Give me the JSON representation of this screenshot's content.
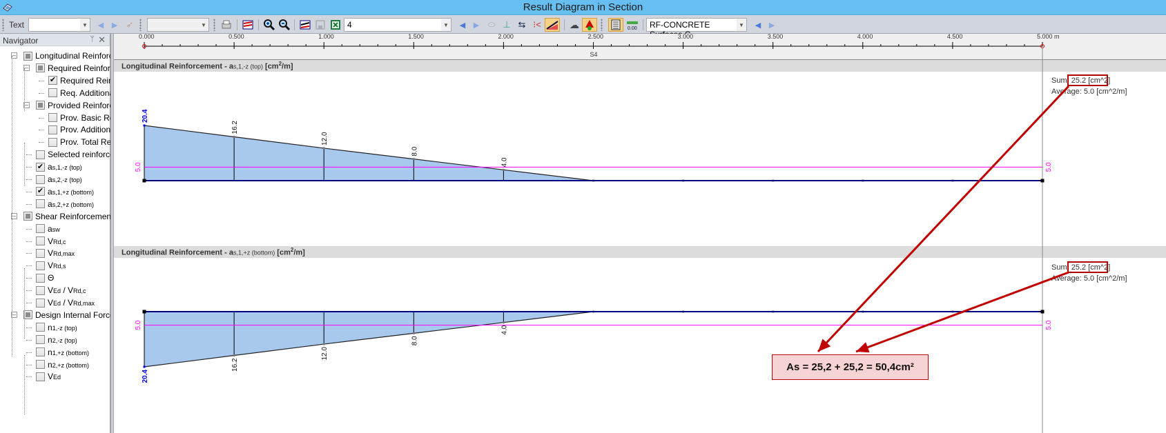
{
  "window": {
    "title": "Result Diagram in Section"
  },
  "toolbar": {
    "text_label": "Text",
    "text_combo_value": "",
    "combo2_value": "",
    "number_field_value": "4",
    "module_combo_value": "RF-CONCRETE Surfaces C"
  },
  "navigator": {
    "title": "Navigator",
    "items": [
      {
        "label": "Longitudinal Reinforc",
        "state": "partial",
        "level": 0,
        "expanded": true
      },
      {
        "label": "Required Reinforc",
        "state": "partial",
        "level": 1,
        "expanded": true
      },
      {
        "label": "Required Reinf",
        "state": "checked",
        "level": 2
      },
      {
        "label": "Req. Additiona",
        "state": "unchecked",
        "level": 2
      },
      {
        "label": "Provided Reinforc",
        "state": "partial",
        "level": 1,
        "expanded": true
      },
      {
        "label": "Prov. Basic Rei",
        "state": "unchecked",
        "level": 2
      },
      {
        "label": "Prov. Addition",
        "state": "unchecked",
        "level": 2
      },
      {
        "label": "Prov. Total Rei",
        "state": "unchecked",
        "level": 2
      },
      {
        "label": "Selected reinforce",
        "state": "unchecked",
        "level": 1
      },
      {
        "label": "a",
        "sub": "s,1,-z (top)",
        "state": "checked",
        "level": 1
      },
      {
        "label": "a",
        "sub": "s,2,-z (top)",
        "state": "unchecked",
        "level": 1
      },
      {
        "label": "a",
        "sub": "s,1,+z (bottom)",
        "state": "checked",
        "level": 1
      },
      {
        "label": "a",
        "sub": "s,2,+z (bottom)",
        "state": "unchecked",
        "level": 1
      },
      {
        "label": "Shear Reinforcement",
        "state": "partial",
        "level": 0,
        "expanded": true
      },
      {
        "label": "a",
        "sub": "sw",
        "state": "unchecked",
        "level": 1
      },
      {
        "label": "V",
        "sub": "Rd,c",
        "state": "unchecked",
        "level": 1
      },
      {
        "label": "V",
        "sub": "Rd,max",
        "state": "unchecked",
        "level": 1
      },
      {
        "label": "V",
        "sub": "Rd,s",
        "state": "unchecked",
        "level": 1
      },
      {
        "label": "Θ",
        "sub": "",
        "state": "unchecked",
        "level": 1
      },
      {
        "label": "V",
        "sub": "Ed",
        "label2": " / V",
        "sub2": "Rd,c",
        "state": "unchecked",
        "level": 1
      },
      {
        "label": "V",
        "sub": "Ed",
        "label2": " / V",
        "sub2": "Rd,max",
        "state": "unchecked",
        "level": 1
      },
      {
        "label": "Design Internal Forces",
        "state": "partial",
        "level": 0,
        "expanded": true
      },
      {
        "label": "n",
        "sub": "1,-z (top)",
        "state": "unchecked",
        "level": 1
      },
      {
        "label": "n",
        "sub": "2,-z (top)",
        "state": "unchecked",
        "level": 1
      },
      {
        "label": "n",
        "sub": "1,+z (bottom)",
        "state": "unchecked",
        "level": 1
      },
      {
        "label": "n",
        "sub": "2,+z (bottom)",
        "state": "unchecked",
        "level": 1
      },
      {
        "label": "V",
        "sub": "Ed",
        "state": "unchecked",
        "level": 1
      }
    ]
  },
  "ruler": {
    "ticks": [
      "0.000",
      "0.500",
      "1.000",
      "1.500",
      "2.000",
      "2.500",
      "3.000",
      "3.500",
      "4.000",
      "4.500",
      "5.000 m"
    ],
    "section_label": "S4"
  },
  "panels": {
    "top": {
      "title": "Longitudinal Reinforcement - a",
      "title_sub": "s,1,-z (top)",
      "unit_pre": "[cm",
      "unit_sup": "2",
      "unit_post": "/m]",
      "sum_label": "Sum: ",
      "sum_value": "25.2 [cm^2]",
      "average": "Average: 5.0 [cm^2/m]"
    },
    "bottom": {
      "title": "Longitudinal Reinforcement - a",
      "title_sub": "s,1,+z (bottom)",
      "unit_pre": "[cm",
      "unit_sup": "2",
      "unit_post": "/m]",
      "sum_label": "Sum: ",
      "sum_value": "25.2 [cm^2]",
      "average": "Average: 5.0 [cm^2/m]"
    }
  },
  "callout": {
    "text": "As = 25,2 + 25,2 = 50,4cm²"
  },
  "colors": {
    "fill": "#a8c8ee",
    "average_line": "#ff00ff",
    "max_label": "#0000ee",
    "axis": "#000080",
    "arrow": "#c00000"
  },
  "chart_data": [
    {
      "type": "area",
      "title": "Longitudinal Reinforcement - a s,1,-z (top) [cm2/m]",
      "xlabel": "m",
      "xlim": [
        0,
        5.0
      ],
      "x": [
        0.0,
        0.5,
        1.0,
        1.5,
        2.0,
        2.5,
        3.0,
        3.5,
        4.0,
        4.5,
        5.0
      ],
      "values": [
        20.4,
        16.2,
        12.0,
        8.0,
        4.0,
        0.0,
        0.0,
        0.0,
        0.0,
        0.0,
        0.0
      ],
      "labels": [
        "20.4",
        "16.2",
        "12.0",
        "8.0",
        "4.0"
      ],
      "average": 5.0,
      "average_label": "5.0",
      "direction": "up"
    },
    {
      "type": "area",
      "title": "Longitudinal Reinforcement - a s,1,+z (bottom) [cm2/m]",
      "xlabel": "m",
      "xlim": [
        0,
        5.0
      ],
      "x": [
        0.0,
        0.5,
        1.0,
        1.5,
        2.0,
        2.5,
        3.0,
        3.5,
        4.0,
        4.5,
        5.0
      ],
      "values": [
        20.4,
        16.2,
        12.0,
        8.0,
        4.0,
        0.0,
        0.0,
        0.0,
        0.0,
        0.0,
        0.0
      ],
      "labels": [
        "20.4",
        "16.2",
        "12.0",
        "8.0",
        "4.0"
      ],
      "average": 5.0,
      "average_label": "5.0",
      "direction": "down"
    }
  ]
}
